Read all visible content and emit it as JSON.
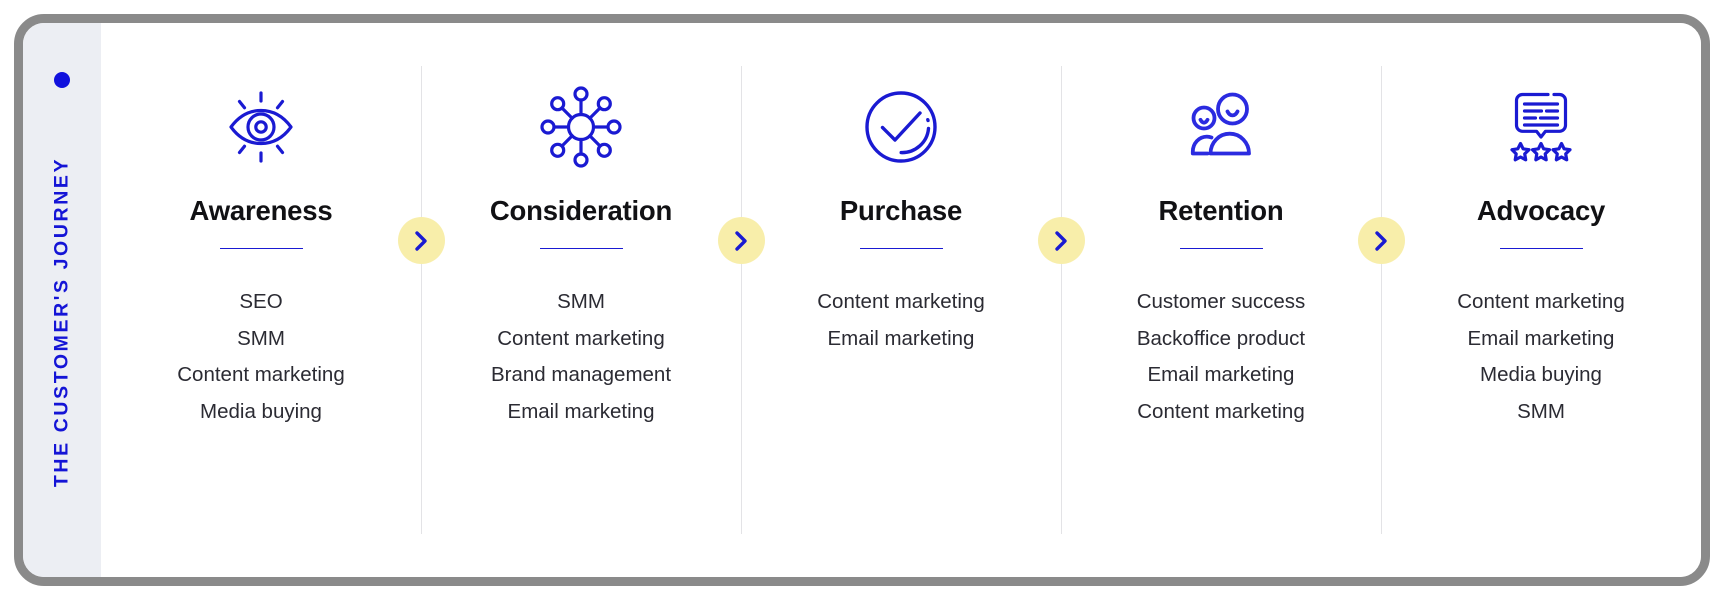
{
  "sidebar": {
    "label": "THE CUSTOMER'S JOURNEY",
    "dot": "bullet-dot"
  },
  "colors": {
    "accent_blue": "#1a1ad2",
    "connector_yellow": "#f8eeaa",
    "sidebar_bg": "#eceef3",
    "frame_border": "#8a8a8a",
    "title_text": "#111114",
    "list_text": "#2b2b33",
    "divider": "#e3e3e6"
  },
  "stages": [
    {
      "title": "Awareness",
      "icon": "eye-icon",
      "items": [
        "SEO",
        "SMM",
        "Content marketing",
        "Media buying"
      ]
    },
    {
      "title": "Consideration",
      "icon": "network-hub-icon",
      "items": [
        "SMM",
        "Content marketing",
        "Brand management",
        "Email marketing"
      ]
    },
    {
      "title": "Purchase",
      "icon": "check-circle-icon",
      "items": [
        "Content marketing",
        "Email marketing"
      ]
    },
    {
      "title": "Retention",
      "icon": "two-people-icon",
      "items": [
        "Customer success",
        "Backoffice product",
        "Email marketing",
        "Content marketing"
      ]
    },
    {
      "title": "Advocacy",
      "icon": "review-stars-icon",
      "items": [
        "Content marketing",
        "Email marketing",
        "Media buying",
        "SMM"
      ]
    }
  ],
  "connectors": [
    {
      "icon": "chevron-right-icon"
    },
    {
      "icon": "chevron-right-icon"
    },
    {
      "icon": "chevron-right-icon"
    },
    {
      "icon": "chevron-right-icon"
    }
  ]
}
